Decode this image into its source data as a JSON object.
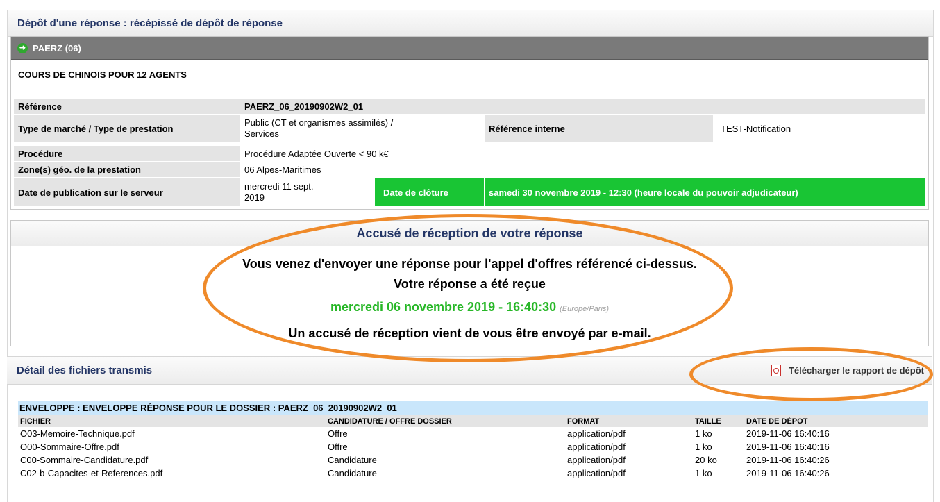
{
  "page": {
    "title": "Dépôt d'une réponse : récépissé de dépôt de réponse"
  },
  "consultation": {
    "code": "PAERZ (06)",
    "subject": "COURS DE CHINOIS POUR 12 AGENTS",
    "reference_label": "Référence",
    "reference_value": "PAERZ_06_20190902W2_01",
    "type_label": "Type de marché / Type de prestation",
    "type_value_1": "Public (CT et organismes assimilés) /",
    "type_value_2": "Services",
    "internal_ref_label": "Référence interne",
    "internal_ref_value": "TEST-Notification",
    "procedure_label": "Procédure",
    "procedure_value": "Procédure Adaptée Ouverte < 90 k€",
    "zone_label": "Zone(s) géo. de la prestation",
    "zone_value": "06 Alpes-Maritimes",
    "pub_date_label": "Date de publication sur le serveur",
    "pub_date_value_1": "mercredi 11 sept.",
    "pub_date_value_2": "2019",
    "closing_label": "Date de clôture",
    "closing_value": "samedi 30 novembre 2019 - 12:30 (heure locale du pouvoir adjudicateur)"
  },
  "acknowledgment": {
    "title": "Accusé de réception de votre réponse",
    "line1": "Vous venez d'envoyer une réponse pour l'appel d'offres référencé ci-dessus.",
    "line2": "Votre réponse a été reçue",
    "date": "mercredi 06 novembre 2019 - 16:40:30",
    "timezone": "(Europe/Paris)",
    "line4": "Un accusé de réception vient de vous être envoyé par e-mail."
  },
  "files": {
    "title": "Détail des fichiers transmis",
    "download_label": "Télécharger le rapport de dépôt",
    "envelope": "ENVELOPPE : ENVELOPPE RÉPONSE POUR LE DOSSIER : PAERZ_06_20190902W2_01",
    "headers": [
      "FICHIER",
      "CANDIDATURE / OFFRE DOSSIER",
      "FORMAT",
      "TAILLE",
      "DATE DE DÉPOT"
    ],
    "rows": [
      [
        "O03-Memoire-Technique.pdf",
        "Offre",
        "application/pdf",
        "1 ko",
        "2019-11-06 16:40:16"
      ],
      [
        "O00-Sommaire-Offre.pdf",
        "Offre",
        "application/pdf",
        "1 ko",
        "2019-11-06 16:40:16"
      ],
      [
        "C00-Sommaire-Candidature.pdf",
        "Candidature",
        "application/pdf",
        "20 ko",
        "2019-11-06 16:40:26"
      ],
      [
        "C02-b-Capacites-et-References.pdf",
        "Candidature",
        "application/pdf",
        "1 ko",
        "2019-11-06 16:40:26"
      ]
    ]
  },
  "colors": {
    "accent_green": "#19c534",
    "annotation_orange": "#ef8a2a",
    "title_blue": "#243666",
    "envelope_blue": "#c9e6fb"
  }
}
